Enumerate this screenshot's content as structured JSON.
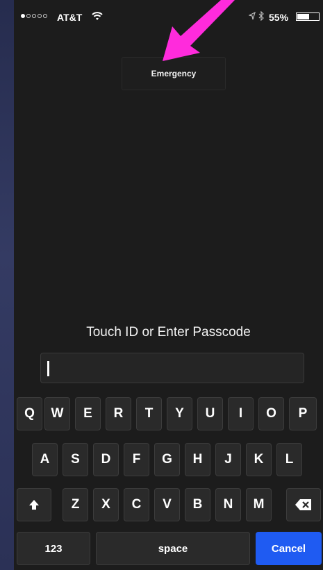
{
  "status_bar": {
    "carrier": "AT&T",
    "battery": "55%",
    "battery_level": 0.55,
    "signal_bars_filled": 1,
    "signal_bars_total": 5
  },
  "emergency_label": "Emergency",
  "prompt": "Touch ID or Enter Passcode",
  "passcode_value": "",
  "keyboard": {
    "row1": [
      "Q",
      "W",
      "E",
      "R",
      "T",
      "Y",
      "U",
      "I",
      "O",
      "P"
    ],
    "row2": [
      "A",
      "S",
      "D",
      "F",
      "G",
      "H",
      "J",
      "K",
      "L"
    ],
    "row3": [
      "Z",
      "X",
      "C",
      "V",
      "B",
      "N",
      "M"
    ],
    "numbers_label": "123",
    "space_label": "space",
    "cancel_label": "Cancel"
  },
  "colors": {
    "cancel": "#1f5bf2",
    "arrow": "#ff2bdc"
  },
  "icons": {
    "wifi": "wifi-icon",
    "location": "location-icon",
    "bluetooth": "bluetooth-icon",
    "battery": "battery-icon",
    "shift": "shift-icon",
    "delete": "delete-icon",
    "arrow": "pointer-arrow-icon"
  }
}
